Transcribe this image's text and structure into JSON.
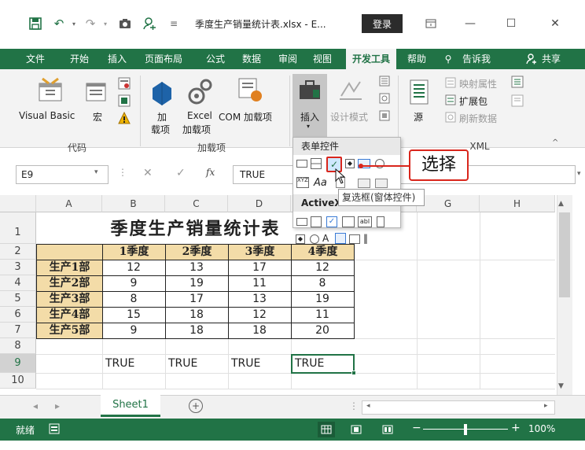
{
  "title": {
    "text": "季度生产销量统计表.xlsx - E...",
    "login": "登录"
  },
  "tabs": [
    "文件",
    "开始",
    "插入",
    "页面布局",
    "公式",
    "数据",
    "审阅",
    "视图",
    "开发工具",
    "帮助",
    "告诉我",
    "共享"
  ],
  "ribbon": {
    "visual_basic": "Visual Basic",
    "macro": "宏",
    "addin": "加",
    "addin2": "载项",
    "excel_addin": "Excel",
    "excel_addin2": "加载项",
    "com_addin": "COM 加载项",
    "insert": "插入",
    "design_mode": "设计模式",
    "source": "源",
    "map_props": "映射属性",
    "expansion": "扩展包",
    "refresh": "刷新数据",
    "groups": {
      "code": "代码",
      "addins": "加载项",
      "xml": "XML"
    }
  },
  "popup": {
    "form_header": "表单控件",
    "activex_header": "ActiveX",
    "tooltip": "复选框(窗体控件)",
    "callout": "选择",
    "aa": "Aa"
  },
  "formula": {
    "namebox": "E9",
    "fx": "fx",
    "value": "TRUE"
  },
  "columns": [
    "A",
    "B",
    "C",
    "D",
    "E",
    "F",
    "G",
    "H"
  ],
  "rows": [
    "1",
    "2",
    "3",
    "4",
    "5",
    "6",
    "7",
    "8",
    "9",
    "10"
  ],
  "sheet": {
    "title": "季度生产销量统计表",
    "headers": [
      "1季度",
      "2季度",
      "3季度",
      "4季度"
    ],
    "data": [
      {
        "name": "生产1部",
        "v": [
          "12",
          "13",
          "17",
          "12"
        ]
      },
      {
        "name": "生产2部",
        "v": [
          "9",
          "19",
          "11",
          "8"
        ]
      },
      {
        "name": "生产3部",
        "v": [
          "8",
          "17",
          "13",
          "19"
        ]
      },
      {
        "name": "生产4部",
        "v": [
          "15",
          "18",
          "12",
          "11"
        ]
      },
      {
        "name": "生产5部",
        "v": [
          "9",
          "18",
          "18",
          "20"
        ]
      }
    ],
    "trues": [
      "TRUE",
      "TRUE",
      "TRUE",
      "TRUE"
    ]
  },
  "sheettab": "Sheet1",
  "status": {
    "ready": "就绪",
    "zoom": "100%"
  },
  "colors": {
    "accent": "#217346",
    "highlight": "#d9261c"
  }
}
